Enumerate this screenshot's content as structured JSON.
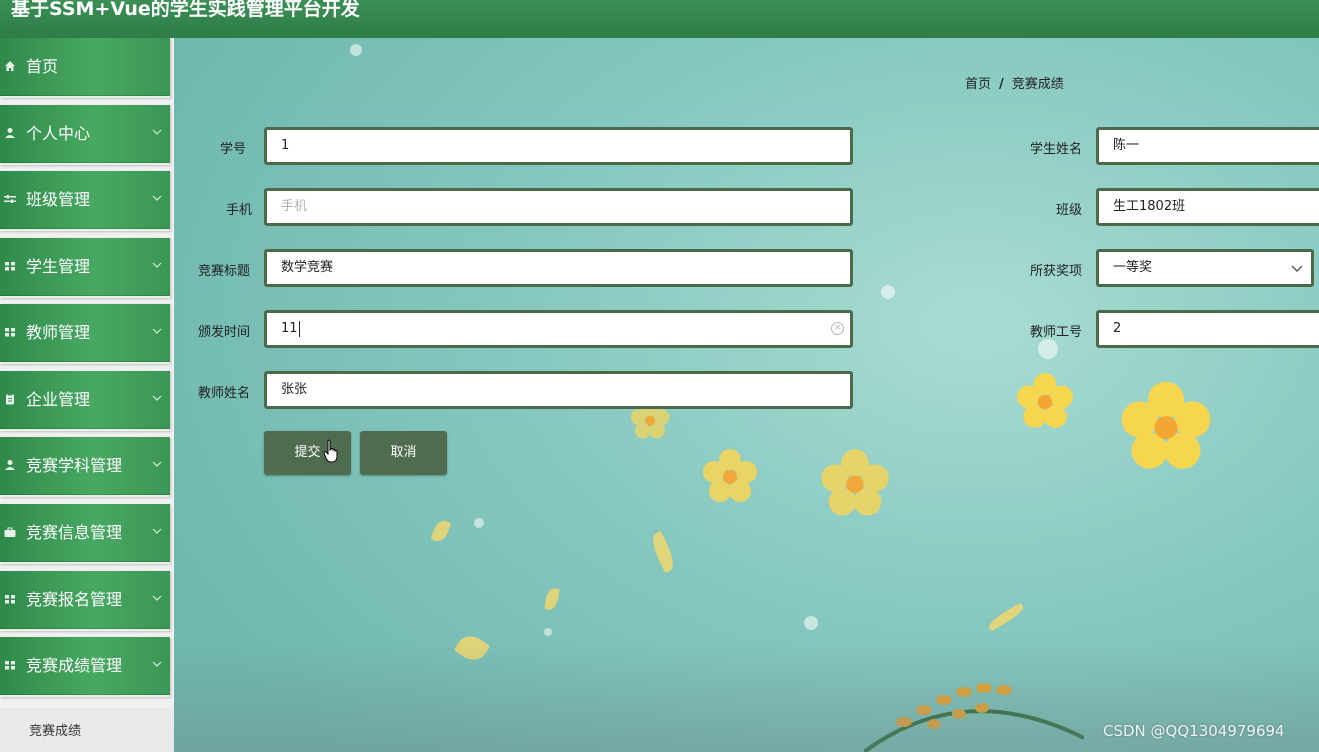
{
  "header": {
    "title": "基于SSM+Vue的学生实践管理平台开发"
  },
  "sidebar": {
    "items": [
      {
        "label": "首页",
        "icon": "home-icon",
        "has_children": false
      },
      {
        "label": "个人中心",
        "icon": "user-icon",
        "has_children": true
      },
      {
        "label": "班级管理",
        "icon": "sliders-icon",
        "has_children": true
      },
      {
        "label": "学生管理",
        "icon": "grid-icon",
        "has_children": true
      },
      {
        "label": "教师管理",
        "icon": "grid-icon",
        "has_children": true
      },
      {
        "label": "企业管理",
        "icon": "clipboard-icon",
        "has_children": true
      },
      {
        "label": "竞赛学科管理",
        "icon": "user-icon",
        "has_children": true
      },
      {
        "label": "竞赛信息管理",
        "icon": "briefcase-icon",
        "has_children": true
      },
      {
        "label": "竞赛报名管理",
        "icon": "grid-icon",
        "has_children": true
      },
      {
        "label": "竞赛成绩管理",
        "icon": "grid-icon",
        "has_children": true
      }
    ],
    "submenu_active": "竞赛成绩"
  },
  "breadcrumb": {
    "home": "首页",
    "separator": "/",
    "current": "竞赛成绩"
  },
  "form": {
    "student_id": {
      "label": "学号",
      "value": "1"
    },
    "student_name": {
      "label": "学生姓名",
      "value": "陈一"
    },
    "phone": {
      "label": "手机",
      "value": "",
      "placeholder": "手机"
    },
    "class_name": {
      "label": "班级",
      "value": "生工1802班"
    },
    "competition_title": {
      "label": "竞赛标题",
      "value": "数学竞赛"
    },
    "award": {
      "label": "所获奖项",
      "value": "一等奖"
    },
    "issue_time": {
      "label": "颁发时间",
      "value": "11"
    },
    "teacher_id": {
      "label": "教师工号",
      "value": "2"
    },
    "teacher_name": {
      "label": "教师姓名",
      "value": "张张"
    }
  },
  "buttons": {
    "submit": "提交",
    "cancel": "取消"
  },
  "watermark": "CSDN @QQ1304979694",
  "colors": {
    "header_green": "#2f7d47",
    "menu_green": "#48a862",
    "input_border": "#4b6a4a",
    "button": "#4f6c4e"
  }
}
